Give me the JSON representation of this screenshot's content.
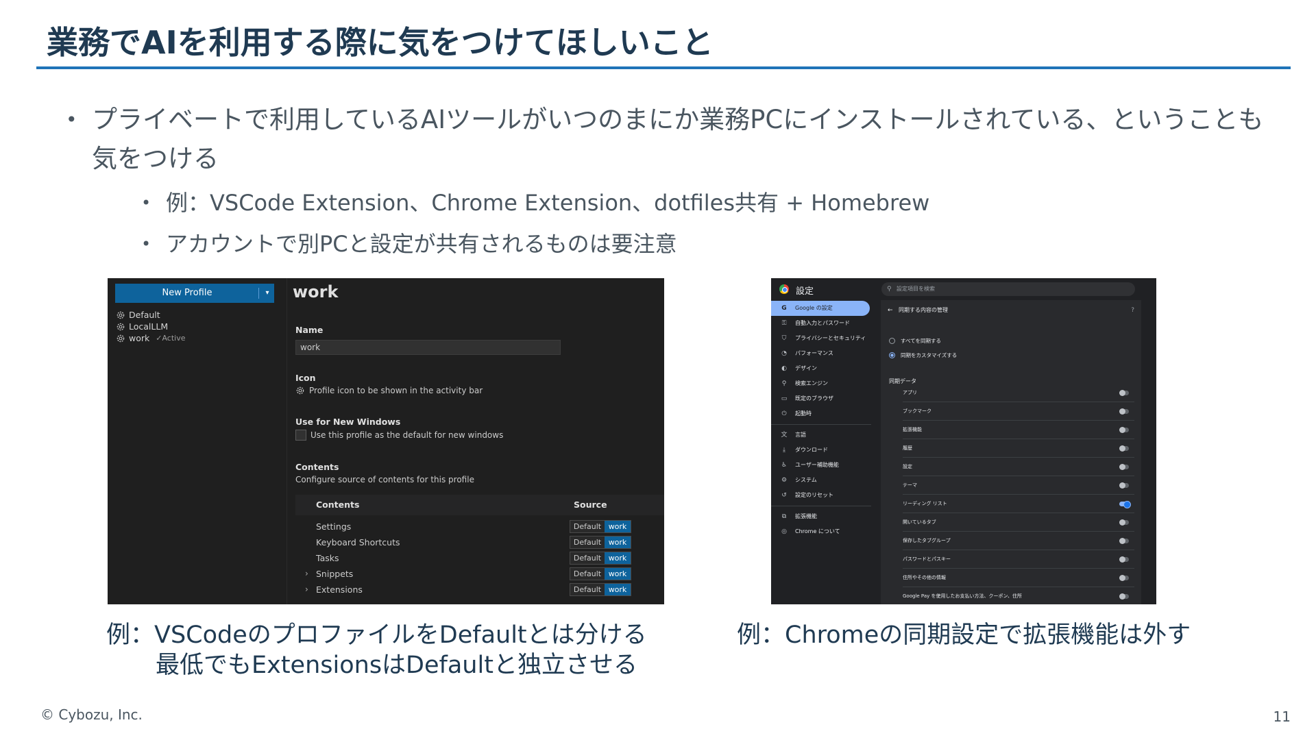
{
  "slide": {
    "title": "業務でAIを利用する際に気をつけてほしいこと",
    "footer": "© Cybozu, Inc.",
    "page_number": "11"
  },
  "bullets": {
    "main": "プライベートで利用しているAIツールがいつのまにか業務PCにインストールされている、ということも気をつける",
    "sub1": "例：VSCode Extension、Chrome Extension、dotfiles共有 + Homebrew",
    "sub2": "アカウントで別PCと設定が共有されるものは要注意"
  },
  "vscode": {
    "new_profile_button": "New Profile",
    "profiles": [
      {
        "name": "Default",
        "status": ""
      },
      {
        "name": "LocalLLM",
        "status": ""
      },
      {
        "name": "work",
        "status": "✓Active"
      }
    ],
    "heading": "work",
    "name_label": "Name",
    "name_value": "work",
    "icon_label": "Icon",
    "icon_text": "Profile icon to be shown in the activity bar",
    "new_windows_label": "Use for New Windows",
    "new_windows_text": "Use this profile as the default for new windows",
    "contents_label": "Contents",
    "contents_desc": "Configure source of contents for this profile",
    "table": {
      "col_contents": "Contents",
      "col_source": "Source",
      "rows": [
        {
          "name": "Settings",
          "default": "Default",
          "work": "work"
        },
        {
          "name": "Keyboard Shortcuts",
          "default": "Default",
          "work": "work"
        },
        {
          "name": "Tasks",
          "default": "Default",
          "work": "work"
        },
        {
          "name": "Snippets",
          "default": "Default",
          "work": "work"
        },
        {
          "name": "Extensions",
          "default": "Default",
          "work": "work"
        }
      ]
    }
  },
  "chrome": {
    "title": "設定",
    "search_placeholder": "設定項目を検索",
    "nav": [
      {
        "label": "Google の設定",
        "icon": "G"
      },
      {
        "label": "自動入力とパスワード",
        "icon": "⚿"
      },
      {
        "label": "プライバシーとセキュリティ",
        "icon": "⛉"
      },
      {
        "label": "パフォーマンス",
        "icon": "◔"
      },
      {
        "label": "デザイン",
        "icon": "◐"
      },
      {
        "label": "検索エンジン",
        "icon": "⚲"
      },
      {
        "label": "既定のブラウザ",
        "icon": "▭"
      },
      {
        "label": "起動時",
        "icon": "⏻"
      },
      {
        "label": "言語",
        "icon": "文"
      },
      {
        "label": "ダウンロード",
        "icon": "⤓"
      },
      {
        "label": "ユーザー補助機能",
        "icon": "♿"
      },
      {
        "label": "システム",
        "icon": "⚙"
      },
      {
        "label": "設定のリセット",
        "icon": "↺"
      },
      {
        "label": "拡張機能",
        "icon": "⧉"
      },
      {
        "label": "Chrome について",
        "icon": "◎"
      }
    ],
    "panel_title": "同期する内容の管理",
    "radio_all": "すべてを同期する",
    "radio_custom": "同期をカスタマイズする",
    "section_label": "同期データ",
    "sync_items": [
      {
        "label": "アプリ",
        "on": false
      },
      {
        "label": "ブックマーク",
        "on": false
      },
      {
        "label": "拡張機能",
        "on": false
      },
      {
        "label": "履歴",
        "on": false
      },
      {
        "label": "設定",
        "on": false
      },
      {
        "label": "テーマ",
        "on": false
      },
      {
        "label": "リーディング リスト",
        "on": true
      },
      {
        "label": "開いているタブ",
        "on": false
      },
      {
        "label": "保存したタブグループ",
        "on": false
      },
      {
        "label": "パスワードとパスキー",
        "on": false
      },
      {
        "label": "住所やその他の情報",
        "on": false
      },
      {
        "label": "Google Pay を使用したお支払い方法、クーポン、住所",
        "on": false
      }
    ]
  },
  "captions": {
    "left_line1": "例：VSCodeのプロファイルをDefaultとは分ける",
    "left_line2": "最低でもExtensionsはDefaultと独立させる",
    "right": "例：Chromeの同期設定で拡張機能は外す"
  },
  "colors": {
    "title": "#1f3a52",
    "rule": "#1f74b8",
    "vscode_accent": "#0e639c",
    "chrome_accent": "#8ab4f8"
  }
}
